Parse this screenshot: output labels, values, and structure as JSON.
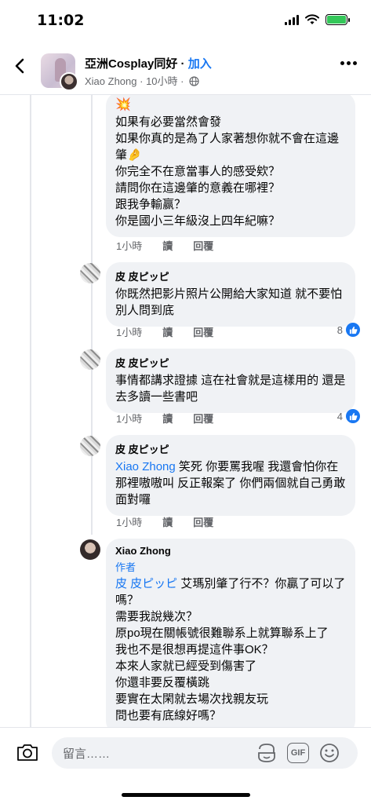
{
  "status": {
    "time": "11:02"
  },
  "header": {
    "group_name": "亞洲Cosplay同好",
    "separator": " · ",
    "join_label": "加入",
    "poster": "Xiao Zhong",
    "time": "10小時",
    "sub_separator": " · "
  },
  "comments": [
    {
      "emoji": "💥",
      "text": "如果有必要當然會發\n如果你真的是為了人家著想你就不會在這邊肇🤌\n你完全不在意當事人的感受欸？\n請問你在這邊肇的意義在哪裡？\n跟我争輸赢？\n你是國小三年級沒上四年紀嘛？",
      "time": "1小時",
      "read": "讀",
      "reply": "回覆"
    },
    {
      "name": "皮 皮ピッピ",
      "text": "你既然把影片照片公開給大家知道 就不要怕別人問到底",
      "time": "1小時",
      "read": "讀",
      "reply": "回覆",
      "likes": "8"
    },
    {
      "name": "皮 皮ピッピ",
      "text": "事情都講求證據 這在社會就是這樣用的 還是去多讀一些書吧",
      "time": "1小時",
      "read": "讀",
      "reply": "回覆",
      "likes": "4"
    },
    {
      "name": "皮 皮ピッピ",
      "mention": "Xiao Zhong",
      "text": " 笑死 你要罵我喔 我還會怕你在那裡嗷嗷叫 反正報案了 你們兩個就自己勇敢面對囉",
      "time": "1小時",
      "read": "讀",
      "reply": "回覆"
    },
    {
      "name": "Xiao Zhong",
      "badge": "作者",
      "mention": "皮 皮ピッピ",
      "text": " 艾瑪別肇了行不？你贏了可以了嗎？\n需要我說幾次？\n原po現在關帳號很難聯系上就算聯系上了\n我也不是很想再提這件事OK？\n本來人家就已經受到傷害了\n你還非要反覆橫跳\n要實在太閑就去場次找親友玩\n問也要有底線好嗎？"
    }
  ],
  "composer": {
    "placeholder": "留言……",
    "gif_label": "GIF"
  },
  "icons": {
    "back": "chevron-left-icon",
    "more": "more-dots-icon",
    "globe": "globe-icon",
    "camera": "camera-icon",
    "sticker": "sticker-icon",
    "gif": "gif-icon",
    "emoji": "smiley-icon",
    "like": "thumbs-up-icon"
  },
  "colors": {
    "accent": "#1877f2",
    "bubble": "#f0f2f5",
    "secondary_text": "#65676b",
    "battery": "#34c759"
  }
}
